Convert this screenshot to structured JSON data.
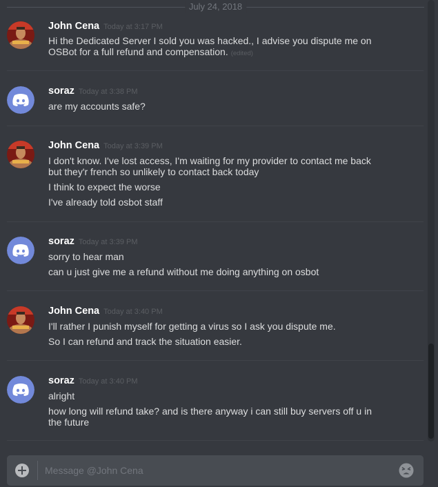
{
  "date_divider": "July 24, 2018",
  "messages": [
    {
      "author": "John Cena",
      "timestamp": "Today at 3:17 PM",
      "lines": [
        "Hi the Dedicated Server I sold you was hacked., I advise you dispute me on OSBot for a full refund and compensation."
      ],
      "edited_label": "(edited)"
    },
    {
      "author": "soraz",
      "timestamp": "Today at 3:38 PM",
      "lines": [
        "are my accounts safe?"
      ]
    },
    {
      "author": "John Cena",
      "timestamp": "Today at 3:39 PM",
      "lines": [
        "I don't know. I've lost access, I'm waiting for my provider to contact me back but they'r french so unlikely to contact back today",
        "I think to expect the worse",
        "I've already told osbot staff"
      ]
    },
    {
      "author": "soraz",
      "timestamp": "Today at 3:39 PM",
      "lines": [
        "sorry to hear man",
        "can u just give me a refund without me doing anything on osbot"
      ]
    },
    {
      "author": "John Cena",
      "timestamp": "Today at 3:40 PM",
      "lines": [
        "I'll rather I punish myself for getting a virus so I ask you dispute me.",
        "So I can refund and track the situation easier."
      ]
    },
    {
      "author": "soraz",
      "timestamp": "Today at 3:40 PM",
      "lines": [
        "alright",
        "how long will refund take? and is there anyway i can still buy servers off u in the future"
      ]
    }
  ],
  "composer": {
    "placeholder": "Message @John Cena"
  },
  "icons": {
    "add": "plus-circle-icon",
    "emoji": "emoji-face-icon",
    "soraz_avatar": "discord-logo-icon",
    "john_avatar": "wrestler-photo"
  },
  "colors": {
    "background": "#36393f",
    "discord_blurple": "#7289da",
    "username": "#ffffff",
    "text": "#dcddde",
    "muted": "#72767d"
  }
}
